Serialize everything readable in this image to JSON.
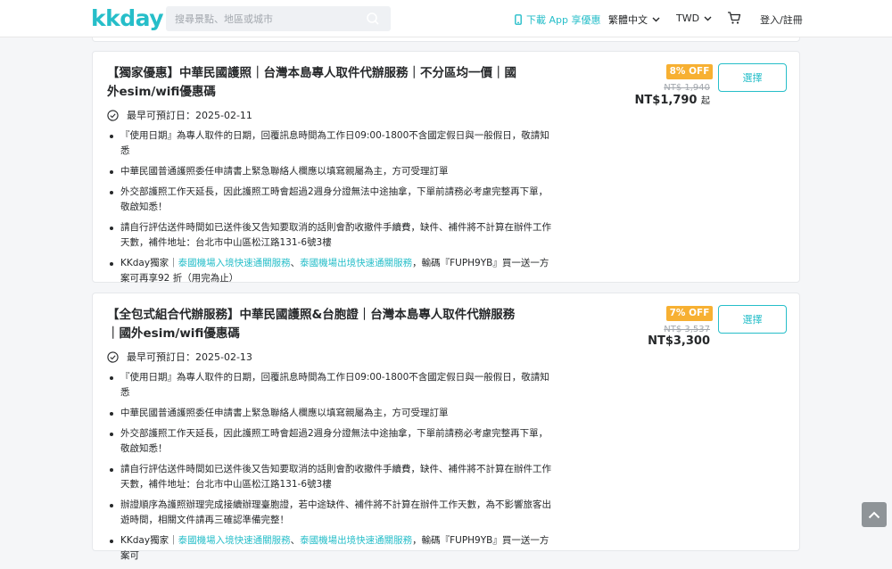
{
  "header": {
    "logo": "kkday",
    "search_placeholder": "搜尋景點、地區或城市",
    "app_promo": "下載 App 享優惠",
    "language": "繁體中文",
    "currency": "TWD",
    "login": "登入/註冊"
  },
  "products": [
    {
      "title": "【獨家優惠】中華民國護照｜台灣本島專人取件代辦服務｜不分區均一價｜國外esim/wifi優惠碼",
      "date_label": "最早可預訂日：2025-02-11",
      "badge": "8% OFF",
      "original_price": "NT$ 1,940",
      "price": "NT$1,790",
      "price_unit": "起",
      "select_label": "選擇",
      "notes": [
        {
          "text": "『使用日期』為專人取件的日期，回覆訊息時間為工作日09:00-1800不含國定假日與一般假日，敬請知悉"
        },
        {
          "text": "中華民國普通護照委任申請書上緊急聯絡人欄應以填寫親屬為主，方可受理訂單"
        },
        {
          "text": "外交部護照工作天延長，因此護照工時會超過2週身分證無法中途抽拿，下單前請務必考慮完整再下單，敬啟知悉！"
        },
        {
          "text": "請自行評估送件時間如已送件後又告知要取消的話則會酌收撤件手續費，缺件、補件將不計算在辦件工作天數，補件地址：台北市中山區松江路131-6號3樓"
        }
      ],
      "promo": {
        "prefix": "KKday獨家｜",
        "link1": "泰國機場入境快速通關服務",
        "sep": "、",
        "link2": "泰國機場出境快速通關服務",
        "suffix": "，輸碼『FUPH9YB』買一送一方案可再享92 折（用完為止）"
      }
    },
    {
      "title": "【全包式組合代辦服務】中華民國護照&台胞證｜台灣本島專人取件代辦服務｜國外esim/wifi優惠碼",
      "date_label": "最早可預訂日：2025-02-13",
      "badge": "7% OFF",
      "original_price": "NT$ 3,537",
      "price": "NT$3,300",
      "price_unit": "",
      "select_label": "選擇",
      "notes": [
        {
          "text": "『使用日期』為專人取件的日期，回覆訊息時間為工作日09:00-1800不含國定假日與一般假日，敬請知悉"
        },
        {
          "text": "中華民國普通護照委任申請書上緊急聯絡人欄應以填寫親屬為主，方可受理訂單"
        },
        {
          "text": "外交部護照工作天延長，因此護照工時會超過2週身分證無法中途抽拿，下單前請務必考慮完整再下單，敬啟知悉！"
        },
        {
          "text": "請自行評估送件時間如已送件後又告知要取消的話則會酌收撤件手續費，缺件、補件將不計算在辦件工作天數，補件地址：台北市中山區松江路131-6號3樓"
        },
        {
          "text": "辦證順序為護照辦理完成接續辦理臺胞證，若中途缺件、補件將不計算在辦件工作天數，為不影響旅客出遊時間，相關文件請再三確認準備完整！"
        }
      ],
      "promo": {
        "prefix": "KKday獨家｜",
        "link1": "泰國機場入境快速通關服務",
        "sep": "、",
        "link2": "泰國機場出境快速通關服務",
        "suffix": "，輸碼『FUPH9YB』買一送一方案可"
      }
    }
  ],
  "colors": {
    "brand": "#26bec9",
    "badge": "#f7b032"
  }
}
